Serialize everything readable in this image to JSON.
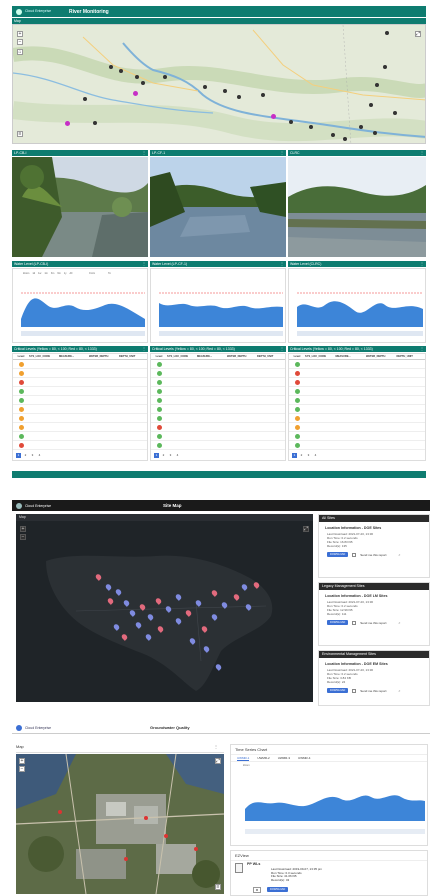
{
  "panel1": {
    "app_brand": "Cloud Enterprise",
    "page_title": "River Monitoring",
    "map_header": "Map",
    "photos": [
      {
        "label": "LP-CB-I"
      },
      {
        "label": "LP-CF-1"
      },
      {
        "label": "CLRC"
      }
    ],
    "charts": [
      {
        "header": "Water Level (LP-CB-I)"
      },
      {
        "header": "Water Level (LP-CF-1)"
      },
      {
        "header": "Water Level (CLRC)"
      }
    ],
    "chart_zoom_label": "Zoom",
    "chart_zoom_options": [
      "1d",
      "1w",
      "1m",
      "3m",
      "6m",
      "1y",
      "All"
    ],
    "chart_from_label": "From",
    "chart_to_label": "To",
    "table_headers": [
      "Level",
      "SYS_LOC_CODE",
      "MEASURE...",
      "WATER_DEPTH",
      "DEPTH_UNIT"
    ],
    "tables": [
      {
        "header": "Critical Levels (Yellow = 80, < 100; Red = 80, < 1333)"
      },
      {
        "header": "Critical Levels (Yellow = 80, < 100; Red = 80, < 1333)"
      },
      {
        "header": "Critical Levels (Yellow = 80, < 100; Red = 80, < 1333)"
      }
    ],
    "table_row_colors": [
      [
        "#f0a030",
        "#f0a030",
        "#e04a3a",
        "#5cb85c",
        "#5cb85c",
        "#f0a030",
        "#f0a030",
        "#f0a030",
        "#5cb85c",
        "#e04a3a"
      ],
      [
        "#5cb85c",
        "#5cb85c",
        "#5cb85c",
        "#5cb85c",
        "#5cb85c",
        "#5cb85c",
        "#5cb85c",
        "#e04a3a",
        "#5cb85c",
        "#5cb85c"
      ],
      [
        "#5cb85c",
        "#e04a3a",
        "#e04a3a",
        "#5cb85c",
        "#5cb85c",
        "#5cb85c",
        "#f0a030",
        "#f0a030",
        "#5cb85c",
        "#5cb85c"
      ]
    ],
    "pages": [
      "1",
      "2",
      "3",
      "4"
    ],
    "colors": {
      "teal": "#0e7c70",
      "marker_pink": "#c62fc6",
      "chart_fill": "#3d85d8"
    }
  },
  "panel2": {
    "brand": "Cloud Enterprise",
    "page_title": "Site Map",
    "map_header": "Map",
    "cards": [
      {
        "header": "All Sites",
        "title": "Location Information - DOE Sites",
        "lines": [
          "Last Download: 2021-07-20, 13:30",
          "Run Time: 0.2 seconds",
          "File Size: 16.83 KB",
          "Record(s): 135"
        ],
        "send_label": "Send me this report"
      },
      {
        "header": "Legacy Management Sites",
        "title": "Location Information - DOE LM Sites",
        "lines": [
          "Last Download: 2021-07-20, 13:30",
          "Run Time: 0.2 seconds",
          "File Size: 12.99 KB",
          "Record(s): 111"
        ],
        "send_label": "Send me this report"
      },
      {
        "header": "Environmental Management Sites",
        "title": "Location Information - DOE EM Sites",
        "lines": [
          "Last Download: 2021-07-20, 13:30",
          "Run Time: 0.2 seconds",
          "File Size: 3.84 KB",
          "Record(s): 24"
        ],
        "send_label": "Send me this report"
      }
    ],
    "download_label": "DOWNLOAD"
  },
  "panel3": {
    "brand": "Cloud Enterprise",
    "page_title": "Groundwater Quality",
    "map_header": "Map",
    "chart_header": "Time Series Chart",
    "tabs": [
      "UWMR-1",
      "UWMR-2",
      "UWMR-3",
      "UWMR-4"
    ],
    "zoom_label": "Zoom",
    "ezview_header": "EZView",
    "ez_title": "PP WLs",
    "ez_lines": [
      "Last Download: 2019-09-07, 13:35 pm",
      "Run Time: 0.3 seconds",
      "File Size: 41.06 KB",
      "Record(s): 43"
    ],
    "download_label": "DOWNLOAD"
  }
}
